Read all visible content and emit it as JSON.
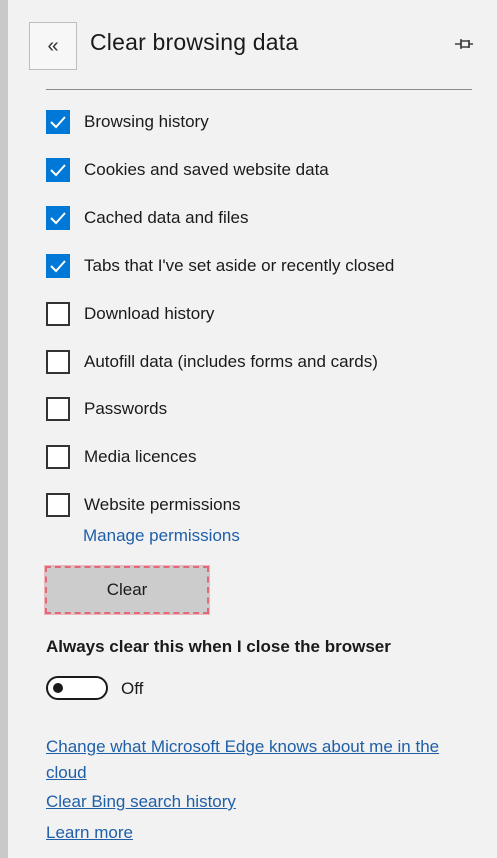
{
  "header": {
    "back_icon": "«",
    "title": "Clear browsing data",
    "pin_icon": "pin-icon"
  },
  "options": [
    {
      "label": "Browsing history",
      "checked": true
    },
    {
      "label": "Cookies and saved website data",
      "checked": true
    },
    {
      "label": "Cached data and files",
      "checked": true
    },
    {
      "label": "Tabs that I've set aside or recently closed",
      "checked": true
    },
    {
      "label": "Download history",
      "checked": false
    },
    {
      "label": "Autofill data (includes forms and cards)",
      "checked": false
    },
    {
      "label": "Passwords",
      "checked": false
    },
    {
      "label": "Media licences",
      "checked": false
    },
    {
      "label": "Website permissions",
      "checked": false
    }
  ],
  "manage_permissions_link": "Manage permissions",
  "clear_button": "Clear",
  "always_clear": {
    "label": "Always clear this when I close the browser",
    "toggle_state": "Off",
    "enabled": false
  },
  "links": {
    "edge_cloud": "Change what Microsoft Edge knows about me in the cloud",
    "bing_history": "Clear Bing search history",
    "learn_more": "Learn more"
  },
  "colors": {
    "accent": "#0078d7",
    "link": "#1f5fa8",
    "panel_bg": "#f2f2f2",
    "button_bg": "#cccccc"
  }
}
